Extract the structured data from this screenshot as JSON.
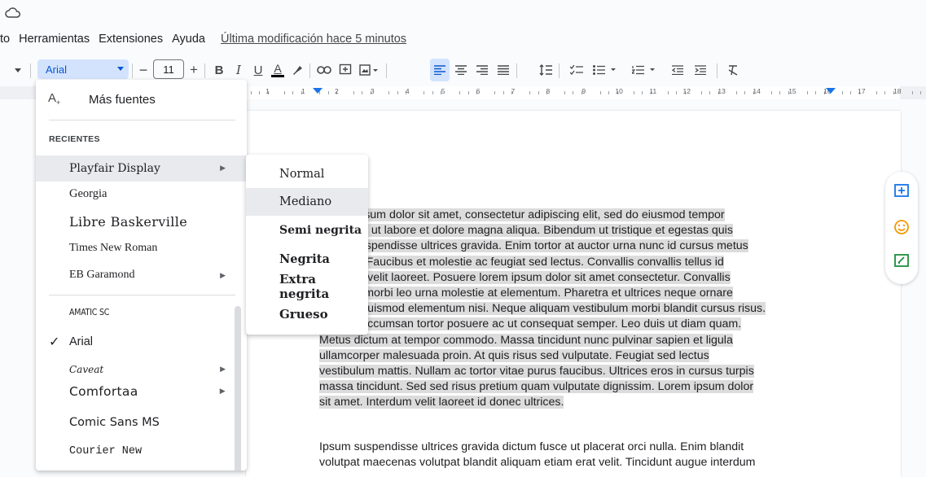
{
  "menubar": {
    "items": [
      "to",
      "Herramientas",
      "Extensiones",
      "Ayuda"
    ],
    "last_edit": "Última modificación hace 5 minutos"
  },
  "toolbar": {
    "font": "Arial",
    "font_size": "11",
    "minus": "−",
    "plus": "+",
    "bold": "B",
    "italic": "I",
    "underline": "U",
    "text_color": "A",
    "accent_color": "#0b57d0",
    "highlight_bg": "#d3e3fd"
  },
  "ruler": {
    "labels": [
      "2",
      "1",
      "1",
      "2",
      "3",
      "4",
      "5",
      "6",
      "7",
      "8",
      "9",
      "10",
      "11",
      "12",
      "13",
      "14",
      "15",
      "16",
      "17",
      "18"
    ]
  },
  "font_menu": {
    "more_fonts": "Más fuentes",
    "recent_header": "RECIENTES",
    "recent": [
      {
        "label": "Playfair Display",
        "has_submenu": true,
        "hovered": true
      },
      {
        "label": "Georgia",
        "has_submenu": false
      },
      {
        "label": "Libre Baskerville",
        "has_submenu": false
      },
      {
        "label": "Times New Roman",
        "has_submenu": false
      },
      {
        "label": "EB Garamond",
        "has_submenu": true
      }
    ],
    "all": [
      {
        "label": "AMATIC SC",
        "has_submenu": false
      },
      {
        "label": "Arial",
        "has_submenu": false,
        "checked": true
      },
      {
        "label": "Caveat",
        "has_submenu": true
      },
      {
        "label": "Comfortaa",
        "has_submenu": true
      },
      {
        "label": "Comic Sans MS",
        "has_submenu": false
      },
      {
        "label": "Courier New",
        "has_submenu": false
      }
    ],
    "check_mark": "✓",
    "submenu_arrow": "▶"
  },
  "weight_menu": {
    "items": [
      "Normal",
      "Mediano",
      "Semi negrita",
      "Negrita",
      "Extra negrita",
      "Grueso"
    ],
    "hovered": "Mediano"
  },
  "document": {
    "para1_lines": [
      "Lorem ipsum dolor sit amet, consectetur adipiscing elit, sed do eiusmod tempor",
      "incididunt ut labore et dolore magna aliqua. Bibendum ut tristique et egestas quis",
      "ipsum suspendisse ultrices gravida. Enim tortor at auctor urna nunc id cursus metus",
      "aliquam. Faucibus et molestie ac feugiat sed lectus. Convallis convallis tellus id",
      "interdum velit laoreet. Posuere lorem ipsum dolor sit amet consectetur. Convallis",
      "posuere morbi leo urna molestie at elementum. Pharetra et ultrices neque ornare",
      "aenean euismod elementum nisi. Neque aliquam vestibulum morbi blandit cursus risus.",
      "Feugiat accumsan tortor posuere ac ut consequat semper. Leo duis ut diam quam.",
      "Metus dictum at tempor commodo. Massa tincidunt nunc pulvinar sapien et ligula",
      "ullamcorper malesuada proin. At quis risus sed vulputate. Feugiat sed lectus",
      "vestibulum mattis. Nullam ac tortor vitae purus faucibus. Ultrices eros in cursus turpis",
      "massa tincidunt. Sed sed risus pretium quam vulputate dignissim. Lorem ipsum dolor",
      "sit amet. Interdum velit laoreet id donec ultrices."
    ],
    "para2_lines": [
      "Ipsum suspendisse ultrices gravida dictum fusce ut placerat orci nulla. Enim blandit",
      "volutpat maecenas volutpat blandit aliquam etiam erat velit. Tincidunt augue interdum"
    ]
  },
  "side_panel": {
    "icons": [
      "add-comment-icon",
      "emoji-reaction-icon",
      "suggest-edits-icon"
    ],
    "icon_color": "#1e8e3e"
  }
}
